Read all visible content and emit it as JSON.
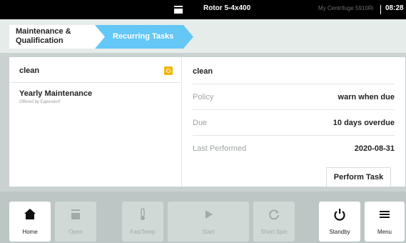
{
  "status_bar": {
    "rotor": "Rotor 5-4x400",
    "device": "My Centrifuge 5910Ri",
    "time": "08:28"
  },
  "breadcrumb": {
    "parent": "Maintenance & Qualification",
    "current": "Recurring Tasks"
  },
  "left_panel": {
    "title": "clean",
    "task": {
      "name": "Yearly Maintenance",
      "offered_by": "Offered by Eppendorf"
    }
  },
  "detail": {
    "title": "clean",
    "rows": [
      {
        "key": "Policy",
        "value": "warn when due"
      },
      {
        "key": "Due",
        "value": "10 days overdue"
      },
      {
        "key": "Last Performed",
        "value": "2020-08-31"
      }
    ],
    "perform_label": "Perform Task"
  },
  "nav": [
    {
      "label": "Home",
      "icon": "home-icon",
      "enabled": true
    },
    {
      "label": "Open",
      "icon": "open-lid-icon",
      "enabled": false
    },
    {
      "label": "FastTemp",
      "icon": "thermometer-icon",
      "enabled": false
    },
    {
      "label": "Start",
      "icon": "play-icon",
      "enabled": false
    },
    {
      "label": "Short Spin",
      "icon": "short-spin-icon",
      "enabled": false
    },
    {
      "label": "Standby",
      "icon": "power-icon",
      "enabled": true
    },
    {
      "label": "Menu",
      "icon": "menu-icon",
      "enabled": true
    }
  ],
  "colors": {
    "accent": "#64c7f5",
    "badge": "#f4b400"
  }
}
